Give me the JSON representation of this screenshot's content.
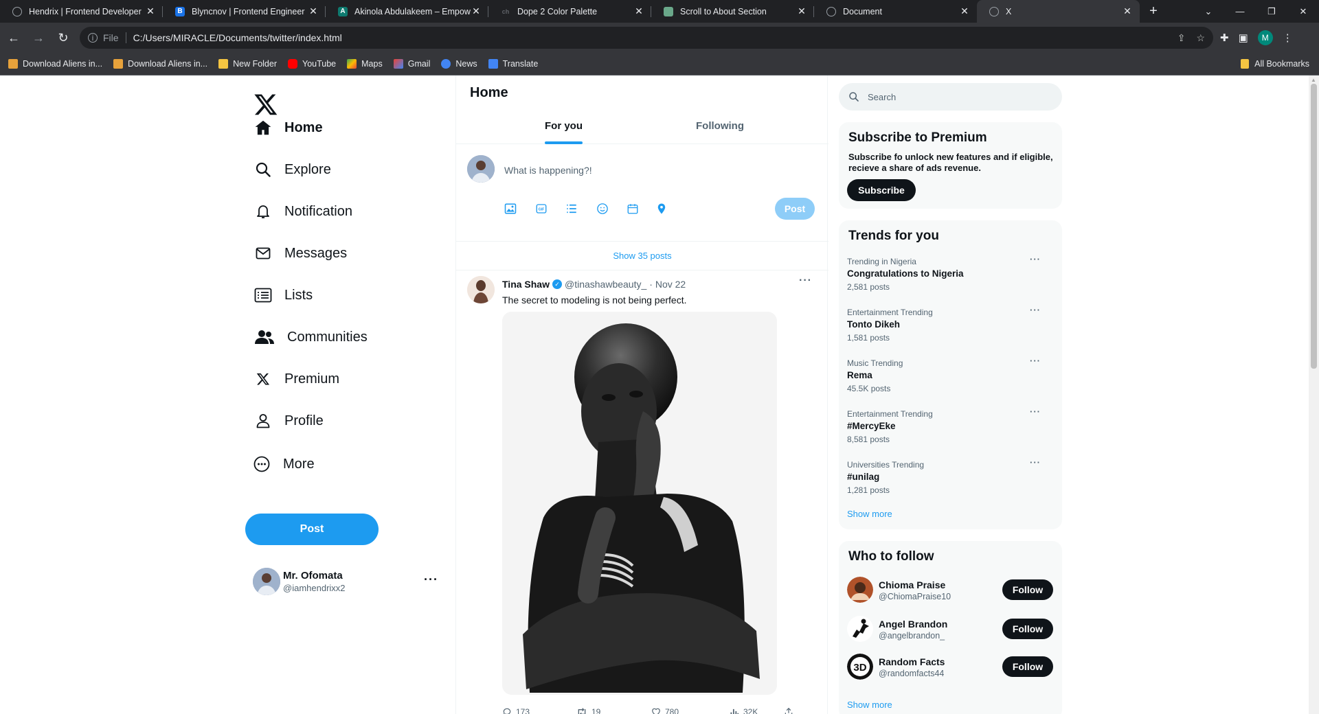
{
  "browser": {
    "tabs": [
      {
        "title": "Hendrix | Frontend Developer",
        "color": "#9aa0a6",
        "glyph": "◍"
      },
      {
        "title": "Blyncnov | Frontend Engineer",
        "color": "#1a73e8",
        "glyph": "B"
      },
      {
        "title": "Akinola Abdulakeem – Empowe",
        "color": "#0e7a6f",
        "glyph": "A"
      },
      {
        "title": "Dope 2 Color Palette",
        "color": "#5f6368",
        "glyph": "ch"
      },
      {
        "title": "Scroll to About Section",
        "color": "#6aa88a",
        "glyph": "◉"
      },
      {
        "title": "Document",
        "color": "#9aa0a6",
        "glyph": "◍"
      },
      {
        "title": "X",
        "color": "#9aa0a6",
        "glyph": ""
      }
    ],
    "address": {
      "scheme": "File",
      "url": "C:/Users/MIRACLE/Documents/twitter/index.html"
    },
    "profile_initial": "M",
    "bookmarks": [
      {
        "label": "Download Aliens in...",
        "color": "#e7a23b"
      },
      {
        "label": "Download Aliens in...",
        "color": "#e7a23b"
      },
      {
        "label": "New Folder",
        "color": "#f5c542"
      },
      {
        "label": "YouTube",
        "color": "#ff0000"
      },
      {
        "label": "Maps",
        "color": "#34a853"
      },
      {
        "label": "Gmail",
        "color": "#ea4335"
      },
      {
        "label": "News",
        "color": "#4285f4"
      },
      {
        "label": "Translate",
        "color": "#4285f4"
      }
    ],
    "all_bookmarks": "All Bookmarks"
  },
  "sidebar": {
    "nav": [
      {
        "label": "Home",
        "icon": "home-icon"
      },
      {
        "label": "Explore",
        "icon": "search-icon"
      },
      {
        "label": "Notification",
        "icon": "bell-icon"
      },
      {
        "label": "Messages",
        "icon": "mail-icon"
      },
      {
        "label": "Lists",
        "icon": "list-icon"
      },
      {
        "label": "Communities",
        "icon": "people-icon"
      },
      {
        "label": "Premium",
        "icon": "x-icon"
      },
      {
        "label": "Profile",
        "icon": "person-icon"
      },
      {
        "label": "More",
        "icon": "more-circle-icon"
      }
    ],
    "post_label": "Post",
    "user": {
      "name": "Mr. Ofomata",
      "handle": "@iamhendrixx2"
    }
  },
  "main": {
    "title": "Home",
    "tabs": [
      "For you",
      "Following"
    ],
    "composer": {
      "placeholder": "What is happening?!",
      "post_label": "Post"
    },
    "show_posts": "Show 35 posts",
    "tweet": {
      "name": "Tina Shaw",
      "handle": "@tinashawbeauty_",
      "date": "· Nov 22",
      "text": "The secret to modeling is not being perfect.",
      "replies": "173",
      "reposts": "19",
      "likes": "780",
      "views": "32K"
    }
  },
  "right": {
    "search_placeholder": "Search",
    "premium": {
      "title": "Subscribe to Premium",
      "text": "Subscribe fo unlock new features and if eligible, recieve a share of ads revenue.",
      "button": "Subscribe"
    },
    "trends": {
      "title": "Trends for you",
      "items": [
        {
          "category": "Trending in Nigeria",
          "topic": "Congratulations to Nigeria",
          "posts": "2,581 posts"
        },
        {
          "category": "Entertainment Trending",
          "topic": "Tonto Dikeh",
          "posts": "1,581 posts"
        },
        {
          "category": "Music Trending",
          "topic": "Rema",
          "posts": "45.5K posts"
        },
        {
          "category": "Entertainment Trending",
          "topic": "#MercyEke",
          "posts": "8,581 posts"
        },
        {
          "category": "Universities Trending",
          "topic": "#unilag",
          "posts": "1,281 posts"
        }
      ],
      "show_more": "Show more"
    },
    "who_to_follow": {
      "title": "Who to follow",
      "items": [
        {
          "name": "Chioma Praise",
          "handle": "@ChiomaPraise10",
          "button": "Follow"
        },
        {
          "name": "Angel Brandon",
          "handle": "@angelbrandon_",
          "button": "Follow"
        },
        {
          "name": "Random Facts",
          "handle": "@randomfacts44",
          "button": "Follow"
        }
      ],
      "show_more": "Show more"
    }
  },
  "colors": {
    "accent": "#1d9bf0",
    "text": "#0f1419",
    "muted": "#536471"
  }
}
